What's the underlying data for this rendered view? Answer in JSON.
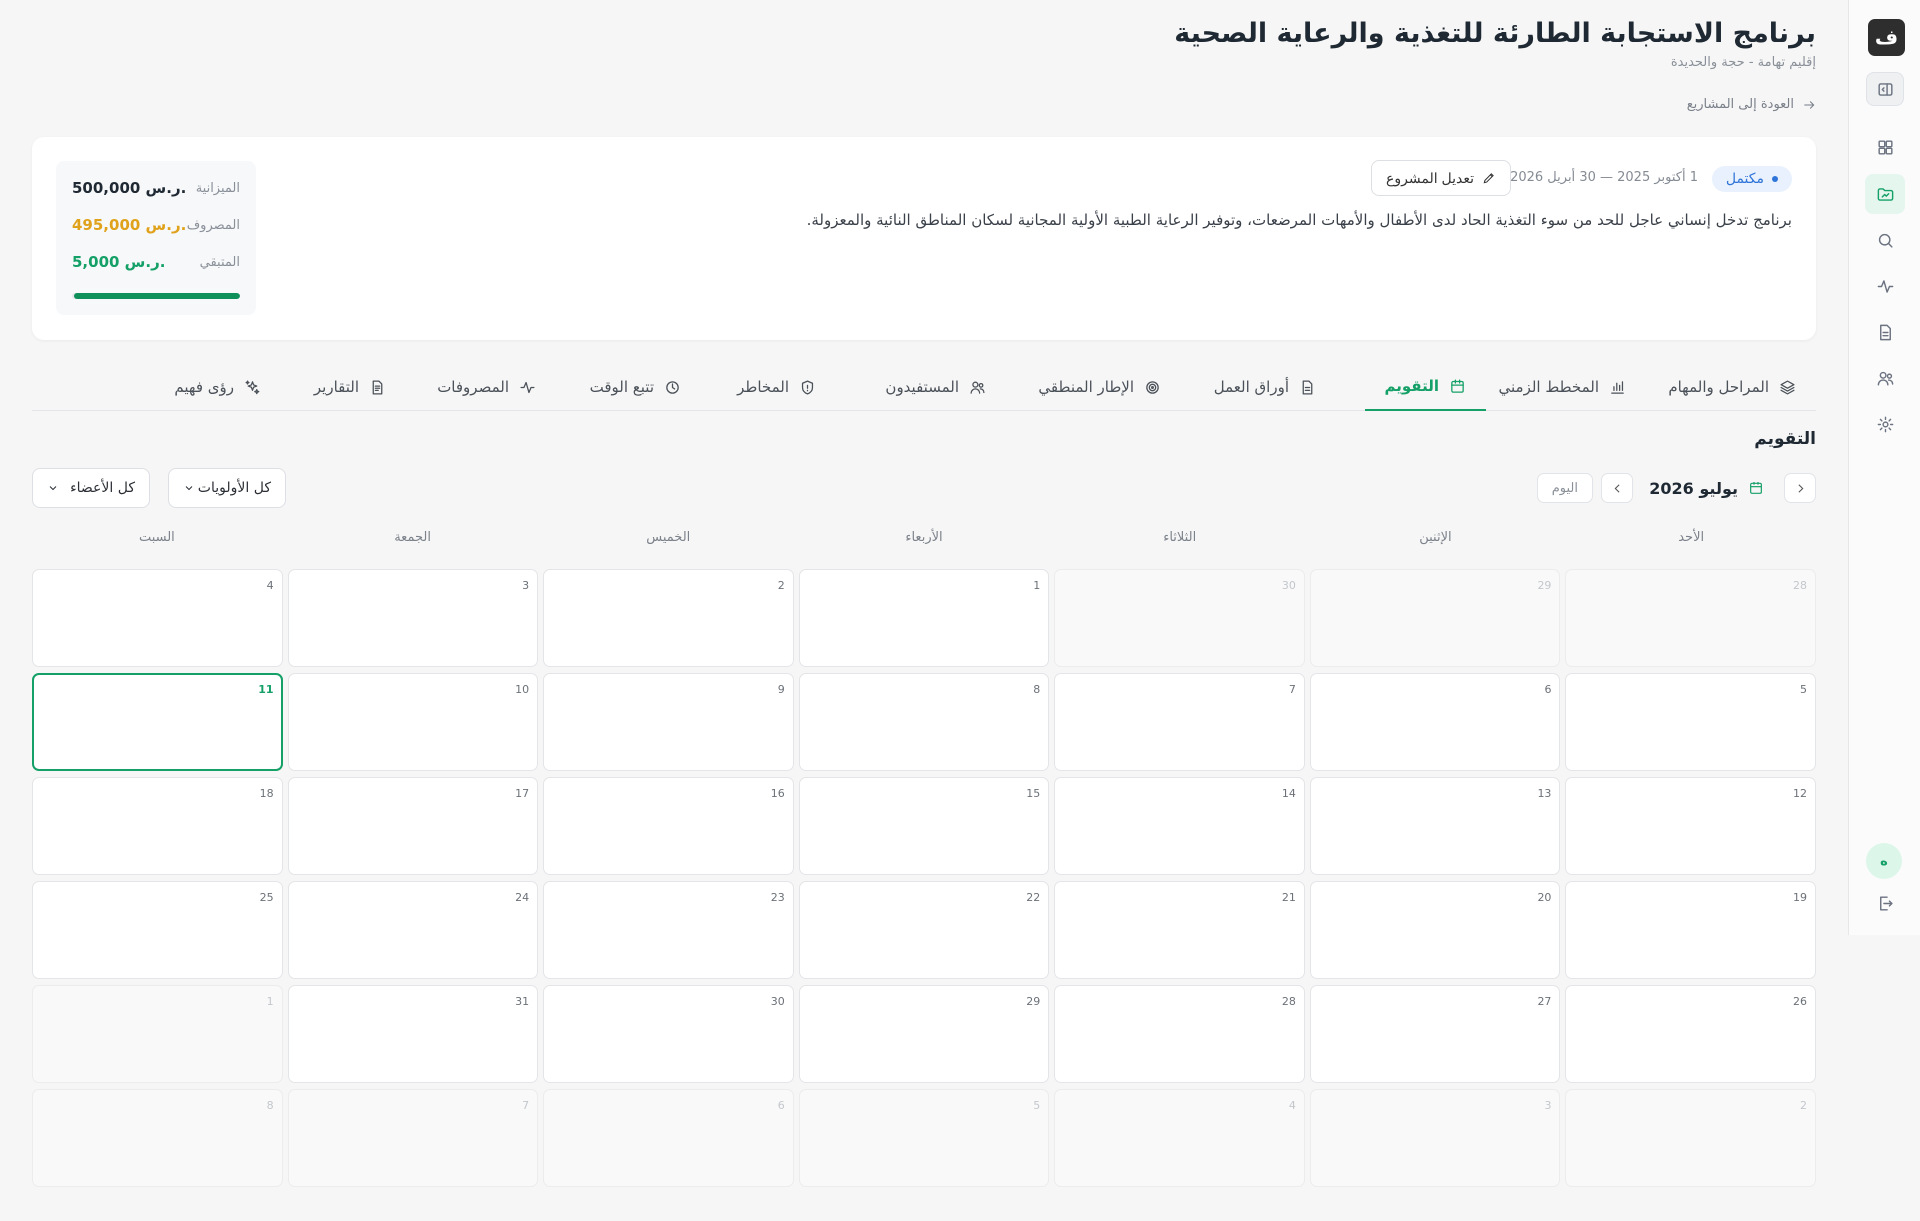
{
  "app": {
    "logo_glyph": "ف"
  },
  "project": {
    "title": "برنامج الاستجابة الطارئة للتغذية والرعاية الصحية",
    "region": "إقليم تهامة - حجة والحديدة",
    "back_label": "العودة إلى المشاريع",
    "status": "مكتمل",
    "date_range": "1 أكتوبر 2025 — 30 أبريل 2026",
    "edit_label": "تعديل المشروع",
    "description": "برنامج تدخل إنساني عاجل للحد من سوء التغذية الحاد لدى الأطفال والأمهات المرضعات، وتوفير الرعاية الطبية الأولية المجانية لسكان المناطق النائية والمعزولة."
  },
  "budget": {
    "budget_label": "الميزانية",
    "budget_value": "500,000 ر.س.",
    "spent_label": "المصروف",
    "spent_value": "495,000 ر.س.",
    "remaining_label": "المتبقي",
    "remaining_value": "5,000 ر.س.",
    "spent_fraction": 0.99
  },
  "tabs": [
    {
      "label": "المراحل والمهام",
      "icon": "layers-icon"
    },
    {
      "label": "المخطط الزمني",
      "icon": "bar-chart-icon"
    },
    {
      "label": "التقويم",
      "icon": "calendar-icon",
      "active": true
    },
    {
      "label": "أوراق العمل",
      "icon": "document-icon"
    },
    {
      "label": "الإطار المنطقي",
      "icon": "target-icon"
    },
    {
      "label": "المستفيدون",
      "icon": "users-icon"
    },
    {
      "label": "المخاطر",
      "icon": "shield-icon"
    },
    {
      "label": "تتبع الوقت",
      "icon": "clock-icon"
    },
    {
      "label": "المصروفات",
      "icon": "activity-icon"
    },
    {
      "label": "التقارير",
      "icon": "report-icon"
    },
    {
      "label": "رؤى فهيم",
      "icon": "sparkles-icon"
    }
  ],
  "calendar": {
    "section_title": "التقويم",
    "month_label": "يوليو 2026",
    "today_label": "اليوم",
    "priority_filter": "كل الأولويات",
    "member_filter": "كل الأعضاء",
    "weekdays": [
      "الأحد",
      "الإثنين",
      "الثلاثاء",
      "الأربعاء",
      "الخميس",
      "الجمعة",
      "السبت"
    ],
    "days": [
      {
        "n": "28",
        "other": true
      },
      {
        "n": "29",
        "other": true
      },
      {
        "n": "30",
        "other": true
      },
      {
        "n": "1"
      },
      {
        "n": "2"
      },
      {
        "n": "3"
      },
      {
        "n": "4"
      },
      {
        "n": "5"
      },
      {
        "n": "6"
      },
      {
        "n": "7"
      },
      {
        "n": "8"
      },
      {
        "n": "9"
      },
      {
        "n": "10"
      },
      {
        "n": "11",
        "today": true
      },
      {
        "n": "12"
      },
      {
        "n": "13"
      },
      {
        "n": "14"
      },
      {
        "n": "15"
      },
      {
        "n": "16"
      },
      {
        "n": "17"
      },
      {
        "n": "18"
      },
      {
        "n": "19"
      },
      {
        "n": "20"
      },
      {
        "n": "21"
      },
      {
        "n": "22"
      },
      {
        "n": "23"
      },
      {
        "n": "24"
      },
      {
        "n": "25"
      },
      {
        "n": "26"
      },
      {
        "n": "27"
      },
      {
        "n": "28"
      },
      {
        "n": "29"
      },
      {
        "n": "30"
      },
      {
        "n": "31"
      },
      {
        "n": "1",
        "other": true
      },
      {
        "n": "2",
        "other": true
      },
      {
        "n": "3",
        "other": true
      },
      {
        "n": "4",
        "other": true
      },
      {
        "n": "5",
        "other": true
      },
      {
        "n": "6",
        "other": true
      },
      {
        "n": "7",
        "other": true
      },
      {
        "n": "8",
        "other": true
      }
    ]
  },
  "user": {
    "avatar_initial": "ه"
  },
  "colors": {
    "accent": "#14a067",
    "status_blue": "#2f74d8",
    "spent_amber": "#e0a21b"
  }
}
